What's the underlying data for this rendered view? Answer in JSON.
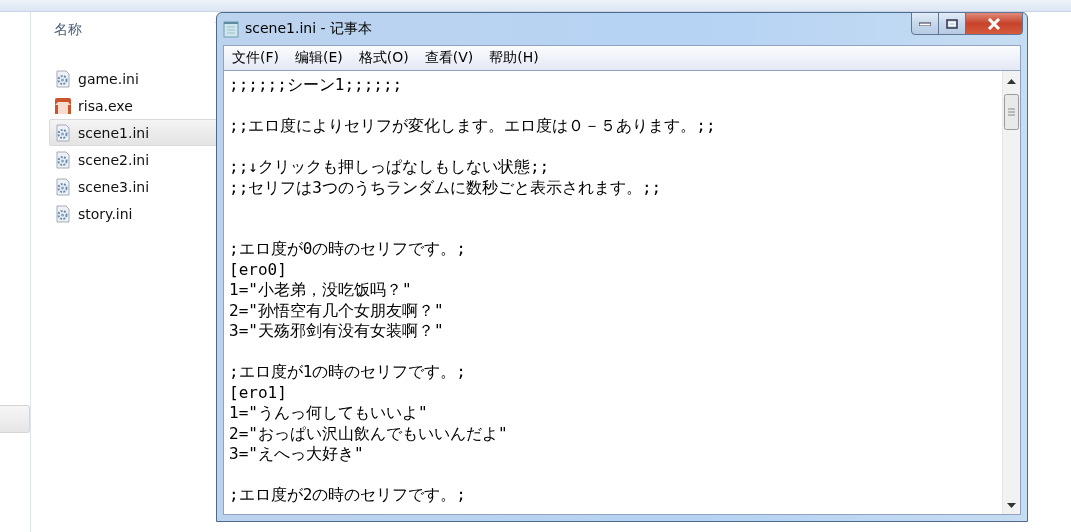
{
  "explorer": {
    "column_header": "名称",
    "files": [
      {
        "name": "game.ini",
        "kind": "config",
        "selected": false
      },
      {
        "name": "risa.exe",
        "kind": "app",
        "selected": false
      },
      {
        "name": "scene1.ini",
        "kind": "config",
        "selected": true
      },
      {
        "name": "scene2.ini",
        "kind": "config",
        "selected": false
      },
      {
        "name": "scene3.ini",
        "kind": "config",
        "selected": false
      },
      {
        "name": "story.ini",
        "kind": "config",
        "selected": false
      }
    ]
  },
  "notepad": {
    "title": "scene1.ini - 记事本",
    "menu": [
      "文件(F)",
      "编辑(E)",
      "格式(O)",
      "查看(V)",
      "帮助(H)"
    ],
    "lines": [
      {
        "kind": "text",
        "text": ";;;;;;シーン1;;;;;;"
      },
      {
        "kind": "blank"
      },
      {
        "kind": "text",
        "text": ";;エロ度によりセリフが変化します。エロ度は０－５あります。;;"
      },
      {
        "kind": "blank"
      },
      {
        "kind": "text",
        "text": ";;↓クリックも押しっぱなしもしない状態;;"
      },
      {
        "kind": "text",
        "text": ";;セリフは3つのうちランダムに数秒ごと表示されます。;;"
      },
      {
        "kind": "blank"
      },
      {
        "kind": "blank"
      },
      {
        "kind": "text",
        "text": ";エロ度が0の時のセリフです。;"
      },
      {
        "kind": "text",
        "text": "[ero0]"
      },
      {
        "kind": "text",
        "text": "1=\"小老弟，没吃饭吗？\""
      },
      {
        "kind": "text",
        "text": "2=\"孙悟空有几个女朋友啊？\""
      },
      {
        "kind": "text",
        "text": "3=\"天殇邪剑有没有女装啊？\""
      },
      {
        "kind": "blank"
      },
      {
        "kind": "text",
        "text": ";エロ度が1の時のセリフです。;"
      },
      {
        "kind": "text",
        "text": "[ero1]"
      },
      {
        "kind": "text",
        "text": "1=\"うんっ何してもいいよ\""
      },
      {
        "kind": "text",
        "text": "2=\"おっぱい沢山飲んでもいいんだよ\""
      },
      {
        "kind": "text",
        "text": "3=\"えへっ大好き\""
      },
      {
        "kind": "blank"
      },
      {
        "kind": "text",
        "text": ";エロ度が2の時のセリフです。;"
      }
    ]
  }
}
